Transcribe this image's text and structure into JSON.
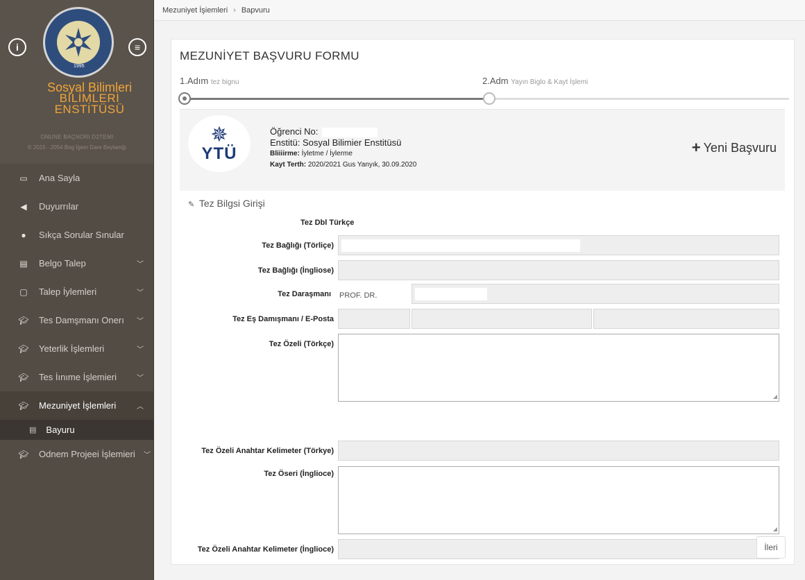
{
  "sidebar": {
    "brand_line1": "Sosyal Bilimleri",
    "brand_line2": "BİLİMLERİ",
    "brand_line3": "ENSTİTÜSÜ",
    "brand_sub1": "ONUNE BAÇNORI D2TEMI",
    "brand_sub2": "© 2015 - 2054 Bog İgem Dare Beylamğı",
    "logo_year": "1995",
    "items": [
      {
        "label": "Ana Sayla",
        "icon": "monitor-icon"
      },
      {
        "label": "Duyurrılar",
        "icon": "megaphone-icon"
      },
      {
        "label": "Sıkça Sorular Sınular",
        "icon": "question-icon"
      },
      {
        "label": "Belgo Talep",
        "icon": "document-icon"
      },
      {
        "label": "Talep İylemleri",
        "icon": "file-icon"
      },
      {
        "label": "Tes Damşmanı Onerı",
        "icon": "graduation-cap-icon"
      },
      {
        "label": "Yeterlik İşlemleri",
        "icon": "graduation-cap-icon"
      },
      {
        "label": "Tes İınıme İşlemieri",
        "icon": "graduation-cap-icon"
      },
      {
        "label": "Mezuniyet İşlemleri",
        "icon": "graduation-cap-icon"
      },
      {
        "label": "Odnem Projeei İşlemieri",
        "icon": "graduation-cap-icon"
      }
    ],
    "submenu_label": "Bayuru"
  },
  "breadcrumb": {
    "item1": "Mezuniyet İşiemleri",
    "item2": "Bapvuru"
  },
  "form": {
    "title": "MEZUNİYET BAŞVURU FORMU",
    "step1_label": "1.Adım",
    "step1_desc": "tez bignu",
    "step2_label": "2.Adm",
    "step2_desc": "Yayın Biglo & Kayt İşlemi",
    "student_no_label": "Öğrenci No:",
    "institute": "Enstitü: Sosyal Bilimier Enstitüsü",
    "bilim_label": "Bliiiirme:",
    "bilim_value": "İyletme / İylerme",
    "kayit_label": "Kayt Terth:",
    "kayit_value": "2020/2021 Gus Yanyık, 30.09.2020",
    "ytu_text": "YTÜ",
    "new_app": "Yeni Başvuru",
    "section_title": "Tez Bilgsi Girişi",
    "lang_header": "Tez Dbl Türkçe",
    "labels": {
      "title_tr": "Tez Bağlığı (Törliçe)",
      "title_en": "Tez Bağlığı (İngliose)",
      "advisor": "Tez Daraşmanı",
      "co_advisor": "Tez Eş Damışmanı / E-Posta",
      "abstract_tr": "Tez Özeli (Törkçe)",
      "keywords_tr": "Tez Özeli Anahtar Kelimeter (Törkye)",
      "abstract_en": "Tez Öseri (İnglioce)",
      "keywords_en": "Tez Özeli Anahtar Kelimeter (İnglioce)"
    },
    "advisor_title": "PROF. DR.",
    "next_button": "İleri"
  }
}
